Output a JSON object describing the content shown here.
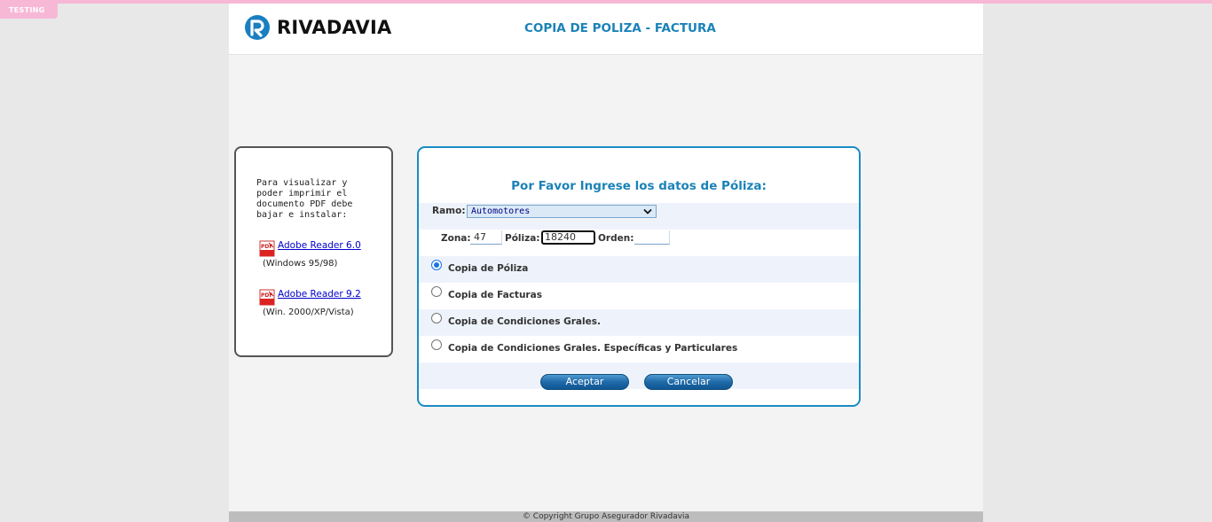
{
  "env_badge": "TESTING",
  "header": {
    "brand": "RIVADAVIA",
    "title": "COPIA DE POLIZA - FACTURA"
  },
  "sidebar": {
    "intro": "Para visualizar y poder imprimir el documento PDF debe bajar e instalar:",
    "downloads": [
      {
        "label": "Adobe Reader 6.0",
        "note": "(Windows 95/98)",
        "icon": "pdf-icon"
      },
      {
        "label": "Adobe Reader 9.2",
        "note": "(Win. 2000/XP/Vista)",
        "icon": "pdf-icon"
      }
    ]
  },
  "form": {
    "heading": "Por Favor Ingrese los datos de Póliza:",
    "ramo_label": "Ramo:",
    "ramo_value": "Automotores",
    "zona_label": "Zona:",
    "zona_value": "47",
    "poliza_label": "Póliza:",
    "poliza_value": "18240",
    "orden_label": "Orden:",
    "orden_value": "",
    "options": [
      {
        "label": "Copia de Póliza",
        "checked": true
      },
      {
        "label": "Copia de Facturas",
        "checked": false
      },
      {
        "label": "Copia de Condiciones Grales.",
        "checked": false
      },
      {
        "label": "Copia de Condiciones Grales. Específicas y Particulares",
        "checked": false
      }
    ],
    "accept_label": "Aceptar",
    "cancel_label": "Cancelar"
  },
  "footer": {
    "copyright": "© Copyright Grupo Asegurador Rivadavia"
  },
  "colors": {
    "accent": "#1a82b8",
    "border_accent": "#1a8bc4",
    "env_badge": "#f7b8d6",
    "button": "#1f6aa8"
  }
}
